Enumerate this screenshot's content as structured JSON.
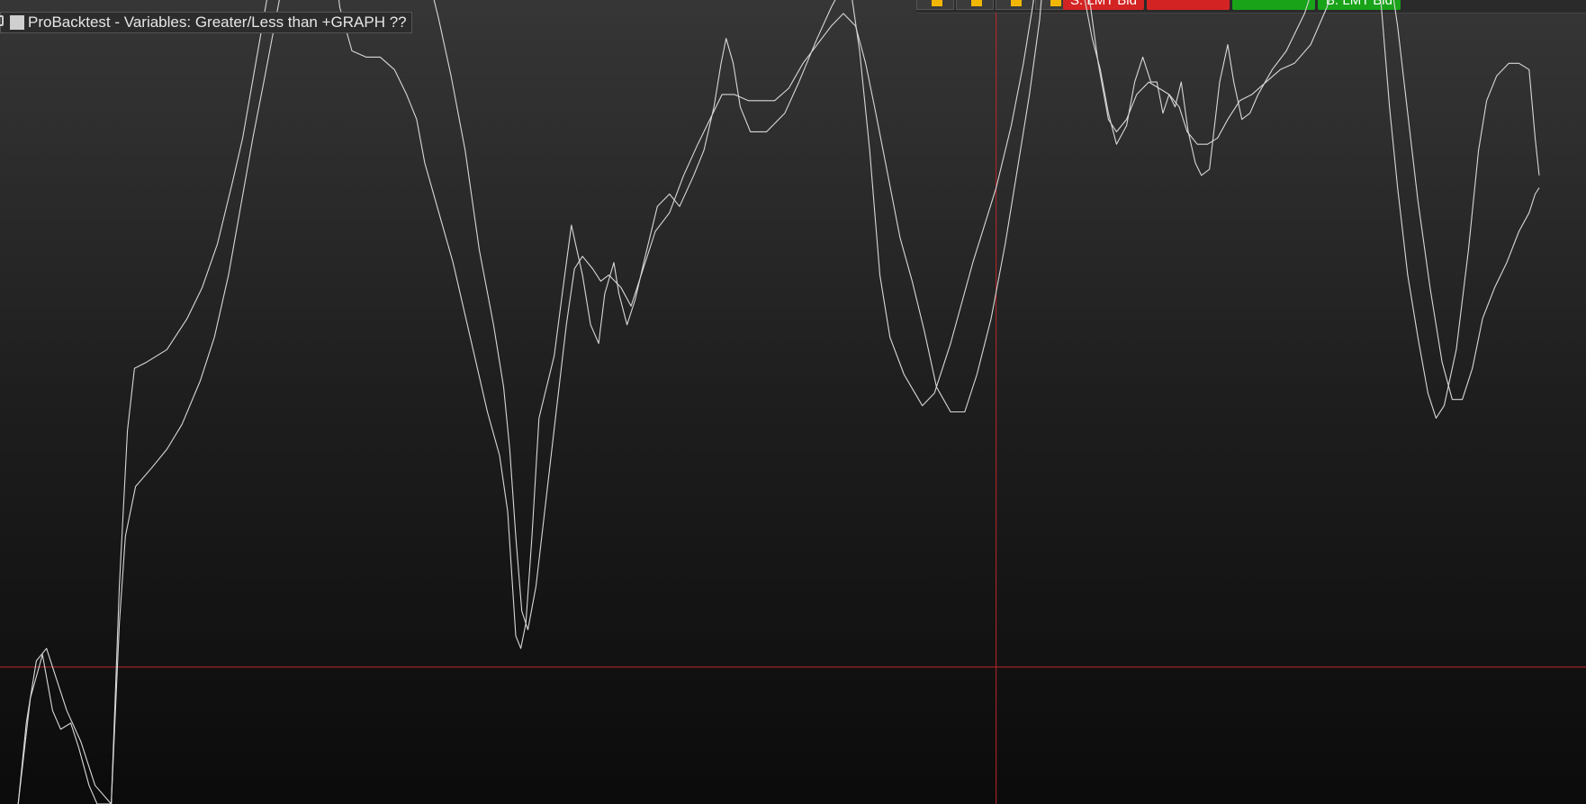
{
  "indicator": {
    "title": "ProBacktest - Variables: Greater/Less than  +GRAPH ??"
  },
  "toolbar": {
    "sell_button_label": "S. LMT Bid",
    "sell_price_label": "",
    "buy_price_label": "",
    "buy_button_label": "B. LMT Bid"
  },
  "colors": {
    "background_top": "#363636",
    "background_bottom": "#0b0b0b",
    "series_line": "#d8d8d8",
    "crosshair": "#c0272d",
    "sell_button": "#d42323",
    "buy_button": "#18a318",
    "accent_chip": "#1e78d8",
    "lock_icon": "#f2b705"
  },
  "icons": [
    "settings-icon",
    "color-swatch-icon",
    "lock-icon"
  ],
  "chart_data": {
    "type": "line",
    "grid": false,
    "legend": "none",
    "ylim": [
      -15,
      100
    ],
    "xlim": [
      0,
      1522
    ],
    "crosshair": {
      "x": 985,
      "y": 7
    },
    "series": [
      {
        "values": [
          [
            18,
            -15
          ],
          [
            30,
            2
          ],
          [
            42,
            9
          ],
          [
            52,
            0
          ],
          [
            60,
            -3
          ],
          [
            70,
            -2
          ],
          [
            78,
            -6
          ],
          [
            88,
            -12
          ],
          [
            96,
            -15
          ],
          [
            110,
            -15
          ],
          [
            118,
            20
          ],
          [
            126,
            45
          ],
          [
            133,
            55
          ],
          [
            145,
            56
          ],
          [
            165,
            58
          ],
          [
            185,
            63
          ],
          [
            200,
            68
          ],
          [
            215,
            75
          ],
          [
            230,
            85
          ],
          [
            240,
            92
          ],
          [
            255,
            106
          ],
          [
            270,
            120
          ],
          [
            285,
            129
          ],
          [
            296,
            137
          ],
          [
            306,
            138
          ],
          [
            316,
            133
          ],
          [
            326,
            126
          ],
          [
            336,
            113
          ],
          [
            348,
            106
          ],
          [
            362,
            105
          ],
          [
            376,
            105
          ],
          [
            390,
            103
          ],
          [
            402,
            99
          ],
          [
            412,
            95
          ],
          [
            420,
            88
          ],
          [
            434,
            80
          ],
          [
            448,
            72
          ],
          [
            465,
            60
          ],
          [
            482,
            48
          ],
          [
            494,
            41
          ],
          [
            502,
            32
          ],
          [
            506,
            22
          ],
          [
            510,
            12
          ],
          [
            515,
            10
          ],
          [
            520,
            14
          ],
          [
            526,
            28
          ],
          [
            533,
            47
          ],
          [
            548,
            57
          ],
          [
            556,
            67
          ],
          [
            565,
            78
          ],
          [
            576,
            70
          ],
          [
            584,
            62
          ],
          [
            592,
            59
          ],
          [
            598,
            67
          ],
          [
            607,
            72
          ],
          [
            612,
            67
          ],
          [
            620,
            62
          ],
          [
            628,
            66
          ],
          [
            638,
            73
          ],
          [
            650,
            81
          ],
          [
            662,
            83
          ],
          [
            672,
            81
          ],
          [
            686,
            86
          ],
          [
            696,
            90
          ],
          [
            706,
            97
          ],
          [
            713,
            104
          ],
          [
            718,
            108
          ],
          [
            725,
            104
          ],
          [
            732,
            97
          ],
          [
            742,
            93
          ],
          [
            758,
            93
          ],
          [
            776,
            96
          ],
          [
            790,
            101
          ],
          [
            808,
            108
          ],
          [
            822,
            113
          ],
          [
            835,
            117
          ],
          [
            842,
            115
          ],
          [
            850,
            106
          ],
          [
            860,
            90
          ],
          [
            870,
            70
          ],
          [
            880,
            60
          ],
          [
            894,
            54
          ],
          [
            912,
            49
          ],
          [
            924,
            51
          ],
          [
            940,
            59
          ],
          [
            962,
            72
          ],
          [
            985,
            84
          ],
          [
            1000,
            94
          ],
          [
            1012,
            104
          ],
          [
            1022,
            114
          ],
          [
            1030,
            125
          ],
          [
            1036,
            136
          ],
          [
            1043,
            145
          ],
          [
            1050,
            142
          ],
          [
            1058,
            128
          ],
          [
            1066,
            118
          ],
          [
            1073,
            114
          ],
          [
            1080,
            108
          ],
          [
            1088,
            103
          ],
          [
            1096,
            96
          ],
          [
            1104,
            91
          ],
          [
            1114,
            94
          ],
          [
            1122,
            101
          ],
          [
            1130,
            105
          ],
          [
            1138,
            101
          ],
          [
            1144,
            101
          ],
          [
            1150,
            96
          ],
          [
            1156,
            99
          ],
          [
            1162,
            97
          ],
          [
            1168,
            101
          ],
          [
            1175,
            93
          ],
          [
            1182,
            88
          ],
          [
            1188,
            86
          ],
          [
            1196,
            87
          ],
          [
            1206,
            101
          ],
          [
            1214,
            107
          ],
          [
            1220,
            101
          ],
          [
            1228,
            95
          ],
          [
            1236,
            96
          ],
          [
            1244,
            99
          ],
          [
            1258,
            103
          ],
          [
            1272,
            106
          ],
          [
            1290,
            112
          ],
          [
            1306,
            120
          ],
          [
            1320,
            128
          ],
          [
            1330,
            133
          ],
          [
            1340,
            136
          ],
          [
            1350,
            134
          ],
          [
            1358,
            125
          ],
          [
            1366,
            113
          ],
          [
            1374,
            97
          ],
          [
            1382,
            84
          ],
          [
            1392,
            70
          ],
          [
            1402,
            60
          ],
          [
            1412,
            51
          ],
          [
            1420,
            47
          ],
          [
            1428,
            49
          ],
          [
            1440,
            58
          ],
          [
            1452,
            74
          ],
          [
            1462,
            90
          ],
          [
            1470,
            98
          ],
          [
            1480,
            102
          ],
          [
            1492,
            104
          ],
          [
            1502,
            104
          ],
          [
            1512,
            103
          ],
          [
            1518,
            92
          ],
          [
            1522,
            86
          ]
        ]
      },
      {
        "values": [
          [
            18,
            -15
          ],
          [
            26,
            -2
          ],
          [
            36,
            8
          ],
          [
            46,
            10
          ],
          [
            56,
            5
          ],
          [
            66,
            0
          ],
          [
            80,
            -5
          ],
          [
            94,
            -12
          ],
          [
            110,
            -15
          ],
          [
            118,
            14
          ],
          [
            124,
            28
          ],
          [
            134,
            36
          ],
          [
            150,
            39
          ],
          [
            165,
            42
          ],
          [
            180,
            46
          ],
          [
            198,
            53
          ],
          [
            212,
            60
          ],
          [
            226,
            70
          ],
          [
            238,
            81
          ],
          [
            250,
            92
          ],
          [
            262,
            102
          ],
          [
            276,
            114
          ],
          [
            288,
            124
          ],
          [
            300,
            135
          ],
          [
            312,
            141
          ],
          [
            326,
            146
          ],
          [
            340,
            147
          ],
          [
            352,
            148
          ],
          [
            364,
            148
          ],
          [
            378,
            146
          ],
          [
            392,
            142
          ],
          [
            404,
            136
          ],
          [
            414,
            129
          ],
          [
            422,
            119
          ],
          [
            434,
            111
          ],
          [
            446,
            102
          ],
          [
            460,
            90
          ],
          [
            474,
            74
          ],
          [
            488,
            62
          ],
          [
            498,
            52
          ],
          [
            504,
            42
          ],
          [
            510,
            28
          ],
          [
            516,
            16
          ],
          [
            522,
            13
          ],
          [
            530,
            20
          ],
          [
            540,
            34
          ],
          [
            550,
            48
          ],
          [
            560,
            62
          ],
          [
            568,
            71
          ],
          [
            576,
            73
          ],
          [
            586,
            71
          ],
          [
            594,
            69
          ],
          [
            602,
            70
          ],
          [
            614,
            68
          ],
          [
            624,
            65
          ],
          [
            636,
            71
          ],
          [
            648,
            77
          ],
          [
            662,
            80
          ],
          [
            676,
            86
          ],
          [
            690,
            91
          ],
          [
            702,
            95
          ],
          [
            714,
            99
          ],
          [
            726,
            99
          ],
          [
            740,
            98
          ],
          [
            752,
            98
          ],
          [
            766,
            98
          ],
          [
            780,
            100
          ],
          [
            794,
            104
          ],
          [
            808,
            107
          ],
          [
            822,
            110
          ],
          [
            834,
            112
          ],
          [
            846,
            110
          ],
          [
            856,
            104
          ],
          [
            866,
            96
          ],
          [
            878,
            86
          ],
          [
            890,
            76
          ],
          [
            902,
            69
          ],
          [
            914,
            61
          ],
          [
            926,
            52
          ],
          [
            940,
            48
          ],
          [
            954,
            48
          ],
          [
            966,
            54
          ],
          [
            980,
            63
          ],
          [
            994,
            75
          ],
          [
            1006,
            87
          ],
          [
            1018,
            99
          ],
          [
            1028,
            111
          ],
          [
            1036,
            126
          ],
          [
            1044,
            140
          ],
          [
            1052,
            145
          ],
          [
            1060,
            141
          ],
          [
            1068,
            130
          ],
          [
            1076,
            116
          ],
          [
            1086,
            104
          ],
          [
            1096,
            95
          ],
          [
            1104,
            93
          ],
          [
            1114,
            95
          ],
          [
            1124,
            99
          ],
          [
            1136,
            101
          ],
          [
            1146,
            100
          ],
          [
            1156,
            99
          ],
          [
            1166,
            97
          ],
          [
            1174,
            93
          ],
          [
            1184,
            91
          ],
          [
            1194,
            91
          ],
          [
            1204,
            92
          ],
          [
            1214,
            95
          ],
          [
            1226,
            98
          ],
          [
            1238,
            99
          ],
          [
            1252,
            101
          ],
          [
            1266,
            103
          ],
          [
            1280,
            104
          ],
          [
            1296,
            107
          ],
          [
            1312,
            113
          ],
          [
            1326,
            119
          ],
          [
            1340,
            125
          ],
          [
            1352,
            128
          ],
          [
            1362,
            126
          ],
          [
            1372,
            121
          ],
          [
            1382,
            110
          ],
          [
            1392,
            96
          ],
          [
            1402,
            82
          ],
          [
            1414,
            68
          ],
          [
            1426,
            56
          ],
          [
            1436,
            50
          ],
          [
            1446,
            50
          ],
          [
            1456,
            55
          ],
          [
            1466,
            63
          ],
          [
            1478,
            68
          ],
          [
            1490,
            72
          ],
          [
            1502,
            77
          ],
          [
            1512,
            80
          ],
          [
            1518,
            83
          ],
          [
            1522,
            84
          ]
        ]
      }
    ]
  }
}
